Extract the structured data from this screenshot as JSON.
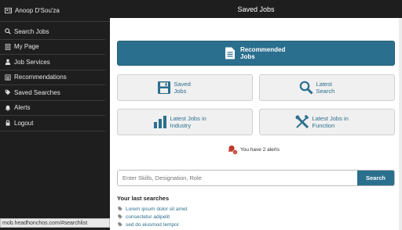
{
  "sidebar": {
    "user": {
      "name": "Anoop D'Sou'za",
      "icon": "user-icon"
    },
    "items": [
      {
        "label": "Search Jobs",
        "icon": "search-icon"
      },
      {
        "label": "My Page",
        "icon": "file-icon"
      },
      {
        "label": "Job Services",
        "icon": "person-icon"
      },
      {
        "label": "Recommendations",
        "icon": "list-icon"
      },
      {
        "label": "Saved Searches",
        "icon": "tag-icon"
      },
      {
        "label": "Alerts",
        "icon": "bell-icon"
      },
      {
        "label": "Logout",
        "icon": "lock-icon"
      }
    ]
  },
  "status_url": "mob.headhonchos.com/#searchlist",
  "header": {
    "title": "Saved Jobs"
  },
  "main": {
    "recommended": {
      "line1": "Recommended",
      "line2": "Jobs"
    },
    "tiles": {
      "saved": {
        "line1": "Saved",
        "line2": "Jobs"
      },
      "latest_search": {
        "line1": "Latest",
        "line2": "Search"
      },
      "industry": {
        "line1": "Latest Jobs in",
        "line2": "Industry"
      },
      "function": {
        "line1": "Latest Jobs in",
        "line2": "Function"
      }
    },
    "alerts_text": "You have 2 alerts",
    "search": {
      "placeholder": "Enter Skills, Designation, Role",
      "button": "Search"
    },
    "last_searches": {
      "title": "Your last searches",
      "items": [
        "Lorem ipsum dolor sit amet",
        "consectetur adipelit",
        "sed do eiusmod tempor"
      ]
    }
  },
  "colors": {
    "accent": "#2b6f8e",
    "sidebar_bg": "#1e1e1e",
    "alert": "#c0392b"
  }
}
